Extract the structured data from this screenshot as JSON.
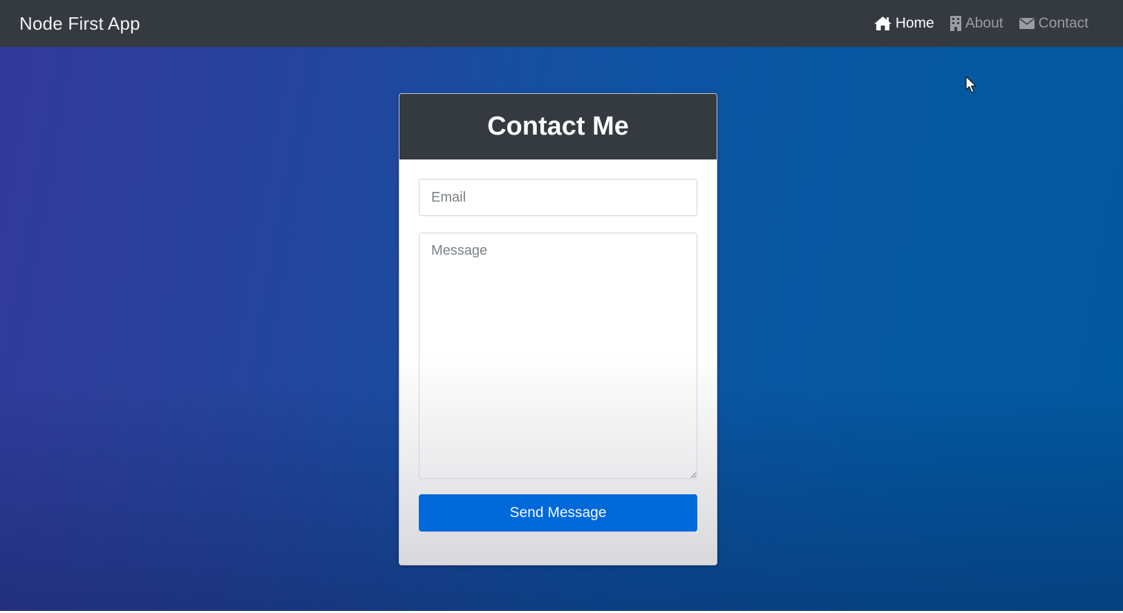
{
  "navbar": {
    "brand": "Node First App",
    "links": [
      {
        "label": "Home",
        "icon": "home-icon",
        "active": true
      },
      {
        "label": "About",
        "icon": "building-icon",
        "active": false
      },
      {
        "label": "Contact",
        "icon": "envelope-icon",
        "active": false
      }
    ]
  },
  "contact_form": {
    "title": "Contact Me",
    "email_placeholder": "Email",
    "email_value": "",
    "message_placeholder": "Message",
    "message_value": "",
    "submit_label": "Send Message"
  },
  "colors": {
    "navbar_bg": "#343a40",
    "primary_button": "#0069d9",
    "background_start": "#343a9a",
    "background_end": "#02589e"
  }
}
